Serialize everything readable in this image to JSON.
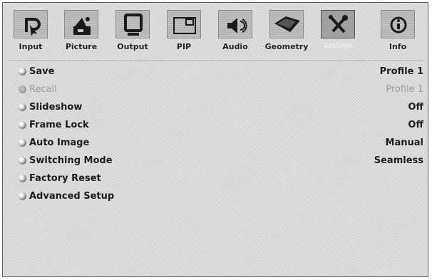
{
  "toolbar": {
    "items": [
      {
        "label": "Input",
        "icon": "input-arrow-icon"
      },
      {
        "label": "Picture",
        "icon": "picture-icon"
      },
      {
        "label": "Output",
        "icon": "monitor-icon"
      },
      {
        "label": "PIP",
        "icon": "pip-icon"
      },
      {
        "label": "Audio",
        "icon": "speaker-icon"
      },
      {
        "label": "Geometry",
        "icon": "geometry-icon"
      },
      {
        "label": "Settings",
        "icon": "tools-icon"
      },
      {
        "label": "Info",
        "icon": "info-icon"
      }
    ],
    "active": "Settings"
  },
  "menu": {
    "items": [
      {
        "label": "Save",
        "value": "Profile 1",
        "enabled": true
      },
      {
        "label": "Recall",
        "value": "Profile 1",
        "enabled": false
      },
      {
        "label": "Slideshow",
        "value": "Off",
        "enabled": true
      },
      {
        "label": "Frame Lock",
        "value": "Off",
        "enabled": true
      },
      {
        "label": "Auto Image",
        "value": "Manual",
        "enabled": true
      },
      {
        "label": "Switching Mode",
        "value": "Seamless",
        "enabled": true
      },
      {
        "label": "Factory Reset",
        "value": "",
        "enabled": true
      },
      {
        "label": "Advanced Setup",
        "value": "",
        "enabled": true
      }
    ]
  },
  "colors": {
    "background": "#dadada",
    "text": "#1e1e1e",
    "disabled_text": "#9c9c9c",
    "tile": "#b5b5b5"
  }
}
